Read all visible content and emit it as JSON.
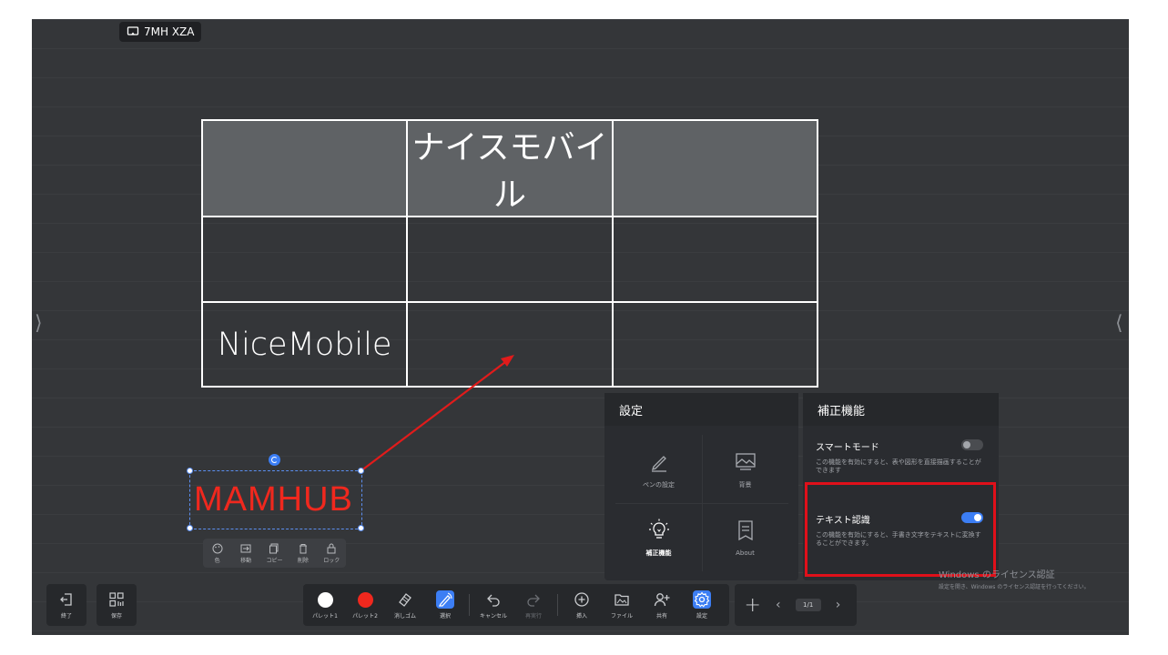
{
  "room_code": "7MH XZA",
  "board": {
    "table": [
      [
        "",
        "ナイスモバイル",
        ""
      ],
      [
        "",
        "",
        ""
      ],
      [
        "NiceMobile",
        "",
        ""
      ]
    ],
    "annotation_text": "MAMHUB",
    "annotation_color": "#f0281e"
  },
  "selection_toolbar": [
    {
      "label": "色",
      "icon": "palette-icon"
    },
    {
      "label": "移動",
      "icon": "move-icon"
    },
    {
      "label": "コピー",
      "icon": "copy-icon"
    },
    {
      "label": "削除",
      "icon": "trash-icon"
    },
    {
      "label": "ロック",
      "icon": "lock-icon"
    }
  ],
  "settings_panel": {
    "title": "設定",
    "items": [
      {
        "label": "ペンの設定",
        "icon": "pen-icon"
      },
      {
        "label": "背景",
        "icon": "image-icon"
      },
      {
        "label": "補正機能",
        "icon": "lightbulb-icon"
      },
      {
        "label": "About",
        "icon": "document-icon"
      }
    ]
  },
  "correction_panel": {
    "title": "補正機能",
    "options": [
      {
        "title": "スマートモード",
        "description": "この機能を有効にすると、表や図形を直接描画することができます",
        "enabled": false
      },
      {
        "title": "テキスト認識",
        "description": "この機能を有効にすると、手書き文字をテキストに変換することができます。",
        "enabled": true
      }
    ]
  },
  "windows_watermark": {
    "line1": "Windows のライセンス認証",
    "line2": "設定を開き、Windows のライセンス認証を行ってください。"
  },
  "left_bar": [
    {
      "label": "終了",
      "icon": "exit-icon"
    },
    {
      "label": "保存",
      "icon": "qr-save-icon"
    }
  ],
  "main_toolbar": [
    {
      "label": "パレット1",
      "icon": "white-dot"
    },
    {
      "label": "パレット2",
      "icon": "red-dot"
    },
    {
      "label": "消しゴム",
      "icon": "eraser-icon"
    },
    {
      "label": "選択",
      "icon": "select-icon"
    },
    {
      "label": "キャンセル",
      "icon": "undo-icon"
    },
    {
      "label": "再実行",
      "icon": "redo-icon"
    },
    {
      "label": "挿入",
      "icon": "plus-circle-icon"
    },
    {
      "label": "ファイル",
      "icon": "folder-icon"
    },
    {
      "label": "共有",
      "icon": "share-user-icon"
    },
    {
      "label": "設定",
      "icon": "gear-icon"
    }
  ],
  "page_nav": {
    "add": "+",
    "prev": "‹",
    "page": "1/1",
    "next": "›"
  },
  "colors": {
    "accent": "#3c7ef4",
    "palette1": "#ffffff",
    "palette2": "#f0281e",
    "highlight": "#e0101a"
  }
}
